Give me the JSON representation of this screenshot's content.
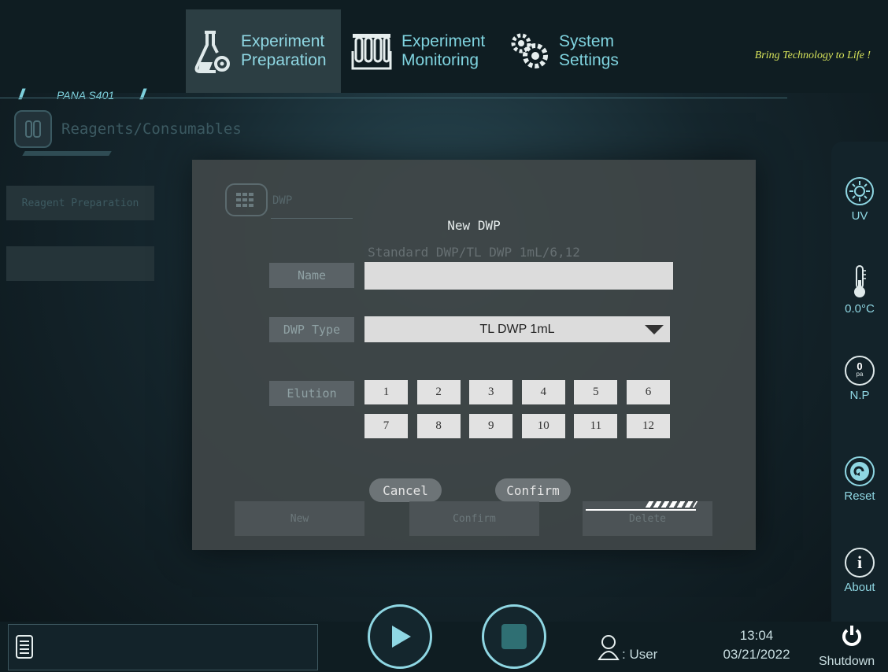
{
  "header": {
    "tabs": [
      {
        "label_line1": "Experiment",
        "label_line2": "Preparation",
        "icon": "flask-gear-icon",
        "active": true
      },
      {
        "label_line1": "Experiment",
        "label_line2": "Monitoring",
        "icon": "test-tubes-icon",
        "active": false
      },
      {
        "label_line1": "System",
        "label_line2": "Settings",
        "icon": "gears-icon",
        "active": false
      }
    ],
    "tagline": "Bring Technology to Life !",
    "model": "PANA S401"
  },
  "background_page": {
    "section_title": "Reagents/Consumables",
    "reagent_button": "Reagent Preparation",
    "dwp_label": "DWP",
    "dwp_item": "Standard DWP/TL DWP 1mL/6,12",
    "new_button": "New",
    "confirm_button": "Confirm",
    "delete_button": "Delete"
  },
  "modal": {
    "title": "New DWP",
    "name_label": "Name",
    "name_value": "",
    "dwp_type_label": "DWP Type",
    "dwp_type_value": "TL DWP 1mL",
    "elution_label": "Elution",
    "elution_cells": [
      "1",
      "2",
      "3",
      "4",
      "5",
      "6",
      "7",
      "8",
      "9",
      "10",
      "11",
      "12"
    ],
    "cancel": "Cancel",
    "confirm": "Confirm"
  },
  "sidebar": {
    "items": [
      {
        "label": "UV",
        "icon": "sun-icon"
      },
      {
        "label": "0.0°C",
        "icon": "thermometer-icon"
      },
      {
        "label": "N.P",
        "icon": "pressure-gauge-icon",
        "value": "0",
        "unit": "pa"
      },
      {
        "label": "Reset",
        "icon": "reset-icon"
      },
      {
        "label": "About",
        "icon": "info-icon"
      }
    ]
  },
  "footer": {
    "user_label": ": User",
    "time": "13:04",
    "date": "03/21/2022",
    "shutdown": "Shutdown"
  },
  "colors": {
    "accent": "#8fd7e3",
    "tagline": "#d8e45a",
    "modal": "#404648"
  }
}
